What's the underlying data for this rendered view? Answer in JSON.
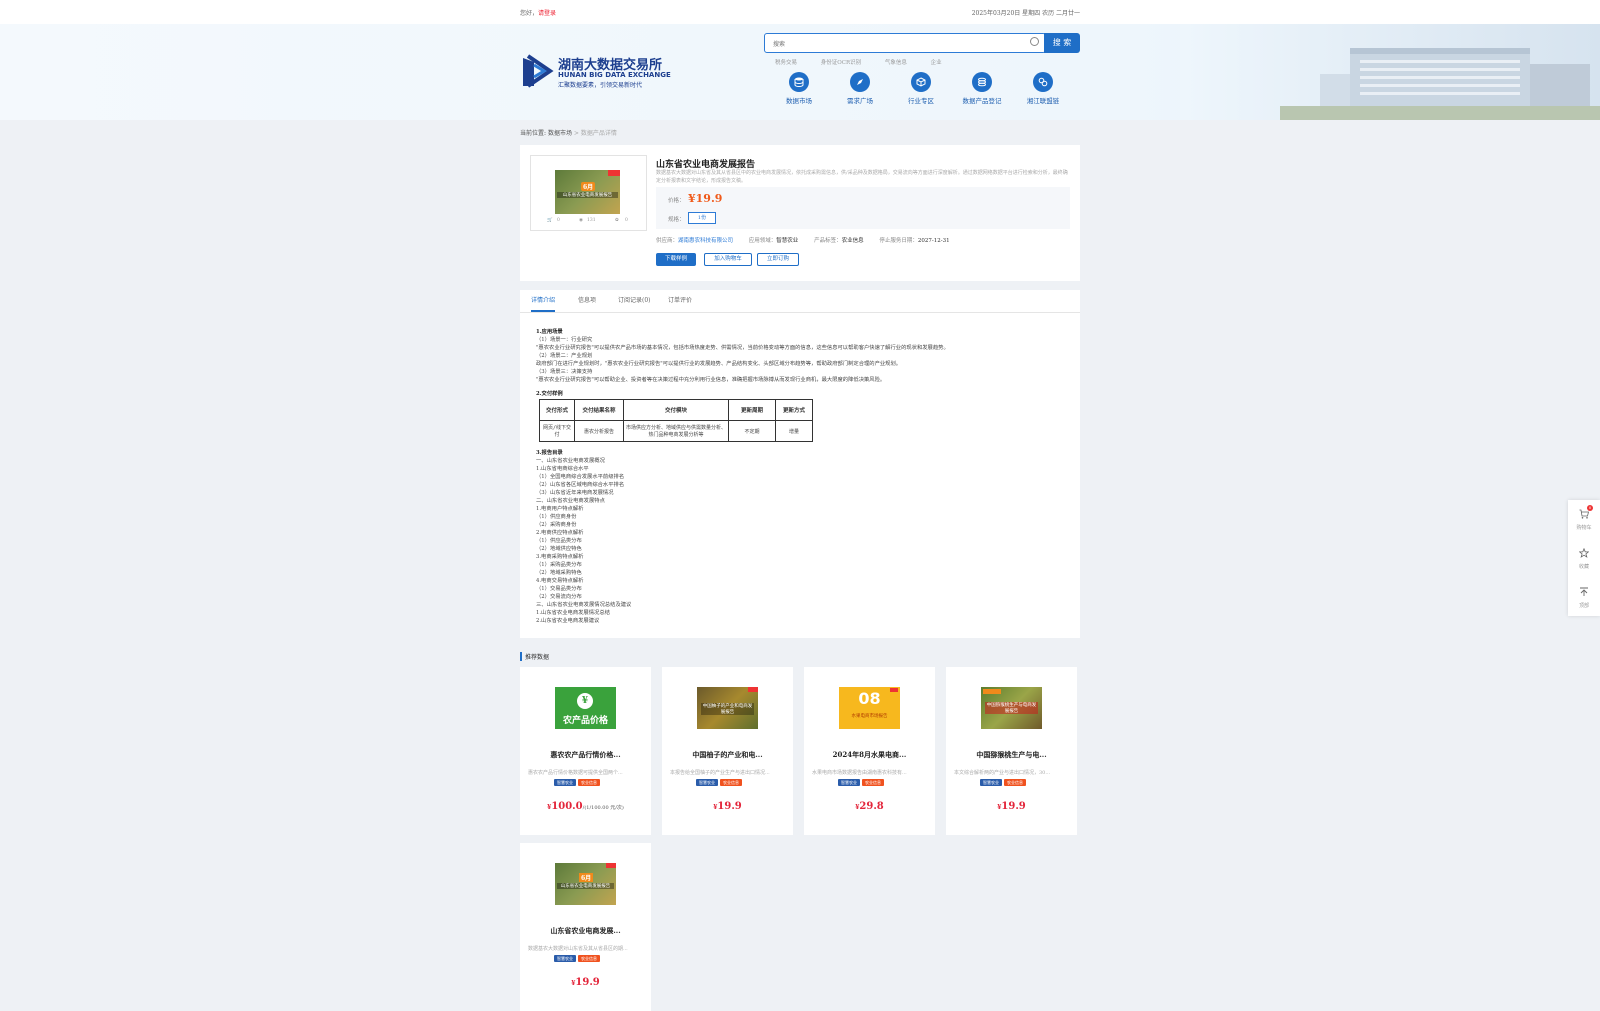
{
  "topbar": {
    "greeting": "您好，",
    "login": "请登录",
    "datetime": "2025年03月20日 星期四 农历 二月廿一"
  },
  "logo": {
    "cn": "湖南大数据交易所",
    "en": "HUNAN BIG DATA EXCHANGE",
    "tagline": "汇聚数据要素，引领交易新时代"
  },
  "search": {
    "placeholder": "搜索",
    "button": "搜 索",
    "hotwords": [
      "税务交易",
      "身份证OCR识别",
      "气象信息",
      "企业"
    ]
  },
  "nav": [
    {
      "label": "数据市场",
      "icon": "database-icon"
    },
    {
      "label": "需求广场",
      "icon": "compass-icon"
    },
    {
      "label": "行业专区",
      "icon": "cube-icon"
    },
    {
      "label": "数据产品登记",
      "icon": "coin-stack-icon"
    },
    {
      "label": "湘江联盟链",
      "icon": "chain-icon"
    }
  ],
  "breadcrumb": {
    "prefix": "当前位置:",
    "market": "数据市场",
    "sep": ">",
    "current": "数据产品详情"
  },
  "product": {
    "image_badge": "6月",
    "image_text": "山东省农业电商发展报告",
    "stats": {
      "cart": "0",
      "views": "131",
      "favorites": "0"
    },
    "title": "山东省农业电商发展报告",
    "desc": "数据基农大数据对山东省及其从省县区中的农业电商发展情况，依托成采购需信息，供/采品种及数据格局，交易流向等方面进行深度解析。通过数据网络数据平台进行检索和分析，最终确定分析报表和文字结论，形成报告文稿。",
    "price_label": "价格：",
    "price": "¥19.9",
    "spec_label": "规格：",
    "spec": "1份",
    "provider_label": "供应商：",
    "provider": "湖南惠农科技有限公司",
    "field_label": "应用领域：",
    "field": "智慧农业",
    "tag_label": "产品标签：",
    "tag": "农业信息",
    "end_label": "停止服务日期：",
    "end": "2027-12-31",
    "btn_sample": "下载样例",
    "btn_cart": "加入购物车",
    "btn_buy": "立即订购"
  },
  "tabs": [
    "详情介绍",
    "信息项",
    "订阅记录(0)",
    "订单评价"
  ],
  "detail": {
    "lines": [
      "1.应用场景",
      "（1）场景一：行业研究",
      "\"惠农农业行业研究报告\"可以提供农产品市场的基本情况，包括市场热度走势、供需情况，当前价格变动等方面的信息，这些信息可以帮助客户快速了解行业的现状和发展趋势。",
      "（2）场景二：产业规划",
      "政府部门在进行产业规划时，\"惠农农业行业研究报告\"可以提供行业的发展趋势、产品结构变化、头部区域分布趋势等，帮助政府部门制定合理的产业规划。",
      "（3）场景三：决策支持",
      "\"惠农农业行业研究报告\"可以帮助企业、投资者等在决策过程中充分利用行业信息，准确把握市场脉搏从而发现行业商机，最大限度的降低决策风险。",
      "2.交付样例"
    ],
    "table": {
      "headers": [
        "交付形式",
        "交付结果名称",
        "交付模块",
        "更新周期",
        "更新方式"
      ],
      "row": [
        "网页/线下交付",
        "惠农分析报告",
        "市场供应方分析、地域供应与供需数量分析、热门品种电商发展分析等",
        "不定期",
        "增量"
      ]
    },
    "toc": [
      "3.报告目录",
      "一、山东省农业电商发展概况",
      "1.山东省电商综合水平",
      "（1）全国电商综合发展水平前级排名",
      "（2）山东省各区域电商综合水平排名",
      "（3）山东省近年来电商发展情况",
      "二、山东省农业电商发展特点",
      "1.电商用户特点解析",
      "（1）供应商身份",
      "（2）采购商身份",
      "2.电商供应特点解析",
      "（1）供应品类分布",
      "（2）地域供应特色",
      "3.电商采购特点解析",
      "（1）采购品类分布",
      "（2）地域采购特色",
      "4.电商交易特点解析",
      "（1）交易品类分布",
      "（2）交易流向分布",
      "三、山东省农业电商发展情况总结及建议",
      "1.山东省农业电商发展情况总结",
      "2.山东省农业电商发展建议"
    ]
  },
  "recommend": {
    "title": "推荐数据",
    "items": [
      {
        "title": "惠农农产品行情价格...",
        "desc": "惠农农产品行情价格数据可提供全国两个...",
        "tag1": "智慧农业",
        "tag2": "农业信息",
        "price": "100.0",
        "unit": "/(1/100.00 元/次)",
        "img": "green"
      },
      {
        "title": "中国柚子的产业和电...",
        "desc": "本报告给全国柚子的产业生产与进出口情况...",
        "tag1": "智慧农业",
        "tag2": "农业信息",
        "price": "19.9",
        "unit": "",
        "img": "pomelo"
      },
      {
        "title": "2024年8月水果电商...",
        "desc": "水果电商市场数据报告由湖南惠农科技有...",
        "tag1": "智慧农业",
        "tag2": "农业信息",
        "price": "29.8",
        "unit": "",
        "img": "orange"
      },
      {
        "title": "中国猕猴桃生产与电...",
        "desc": "本文综合解析两的产业与进出口情况，30...",
        "tag1": "智慧农业",
        "tag2": "农业信息",
        "price": "19.9",
        "unit": "",
        "img": "kiwi"
      },
      {
        "title": "山东省农业电商发展...",
        "desc": "数据基农大数据对山东省及其从省县区的期...",
        "tag1": "智慧农业",
        "tag2": "农业信息",
        "price": "19.9",
        "unit": "",
        "img": "shandong"
      }
    ],
    "img_texts": {
      "green": "农产品价格",
      "pomelo": "中国柚子的产业和电商发展报告",
      "orange_num": "08",
      "orange_text": "水果电商市场报告",
      "kiwi": "中国猕猴桃生产与电商发展报告",
      "shandong": "山东省农业电商发展报告",
      "badge6": "6月"
    },
    "currency": "¥"
  },
  "sidebar": {
    "cart": "购物车",
    "cart_count": "0",
    "favorite": "收藏",
    "top": "顶部"
  },
  "colors": {
    "brand": "#1f6ec7",
    "price": "#f05a1a",
    "tag_blue": "#2a5caa",
    "tag_orange": "#f0521f"
  }
}
